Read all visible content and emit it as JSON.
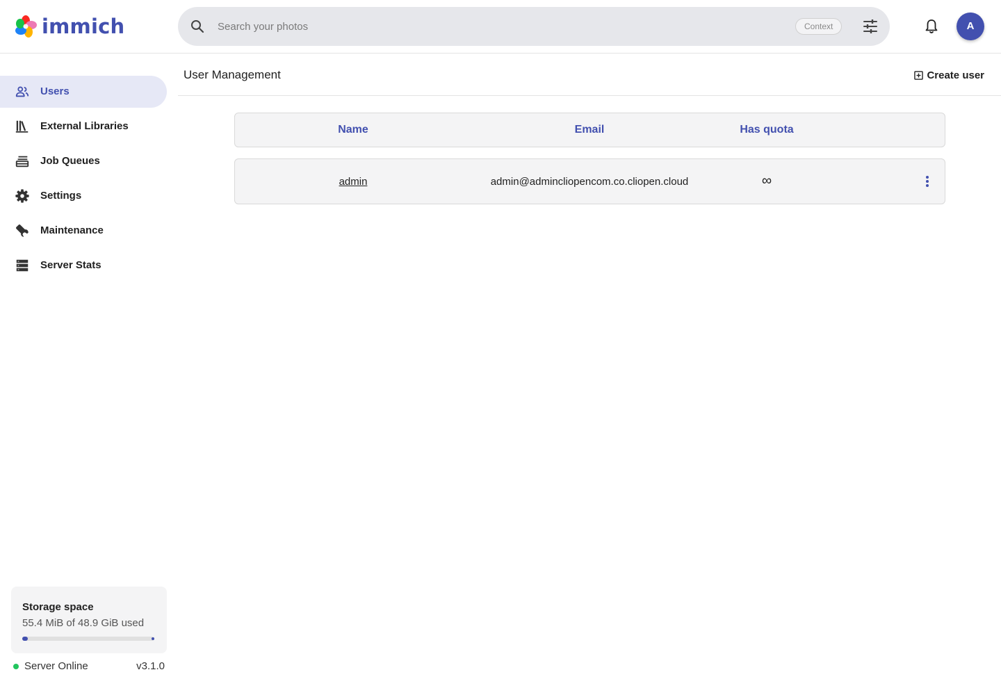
{
  "app": {
    "name": "immich"
  },
  "search": {
    "placeholder": "Search your photos",
    "context_label": "Context"
  },
  "user": {
    "avatar_initial": "A"
  },
  "sidebar": {
    "items": [
      {
        "label": "Users",
        "icon": "users-icon",
        "active": true
      },
      {
        "label": "External Libraries",
        "icon": "library-icon",
        "active": false
      },
      {
        "label": "Job Queues",
        "icon": "job-queues-icon",
        "active": false
      },
      {
        "label": "Settings",
        "icon": "gear-icon",
        "active": false
      },
      {
        "label": "Maintenance",
        "icon": "wrench-icon",
        "active": false
      },
      {
        "label": "Server Stats",
        "icon": "server-icon",
        "active": false
      }
    ],
    "storage": {
      "title": "Storage space",
      "used_text": "55.4 MiB of 48.9 GiB used",
      "used_fraction": 0.0011
    },
    "server": {
      "status": "Server Online",
      "version": "v3.1.0"
    }
  },
  "main": {
    "title": "User Management",
    "create_label": "Create user",
    "table": {
      "columns": [
        "Name",
        "Email",
        "Has quota"
      ],
      "rows": [
        {
          "name": "admin",
          "email": "admin@admincliopencom.co.cliopen.cloud",
          "has_quota": "∞"
        }
      ]
    }
  },
  "colors": {
    "accent": "#4250af",
    "active_bg": "#e6e8f6",
    "online": "#22c55e"
  }
}
